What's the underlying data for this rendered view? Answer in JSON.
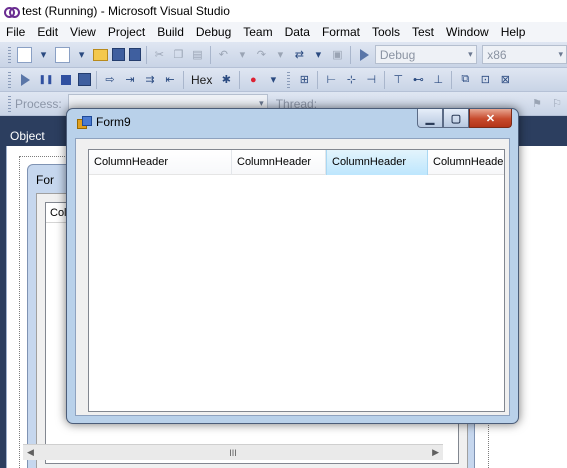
{
  "window": {
    "title": "test (Running) - Microsoft Visual Studio"
  },
  "menu": [
    "File",
    "Edit",
    "View",
    "Project",
    "Build",
    "Debug",
    "Team",
    "Data",
    "Format",
    "Tools",
    "Test",
    "Window",
    "Help"
  ],
  "toolbar": {
    "config_value": "Debug",
    "platform_value": "x86",
    "hex_label": "Hex",
    "process_label": "Process:",
    "thread_label": "Thread:"
  },
  "doc_tab": {
    "label": "Object Bro"
  },
  "background_form": {
    "title": "For",
    "list_header": "Colu",
    "scroll_glyph": "III"
  },
  "form": {
    "title": "Form9",
    "columns": [
      "ColumnHeader",
      "ColumnHeader",
      "ColumnHeader",
      "ColumnHeader"
    ],
    "hot_column_index": 2
  },
  "colors": {
    "ide_dark_blue": "#2c3e5f",
    "toolbar_blue": "#d5deed",
    "close_red": "#c74a2c",
    "header_hover": "#bde6fd"
  }
}
